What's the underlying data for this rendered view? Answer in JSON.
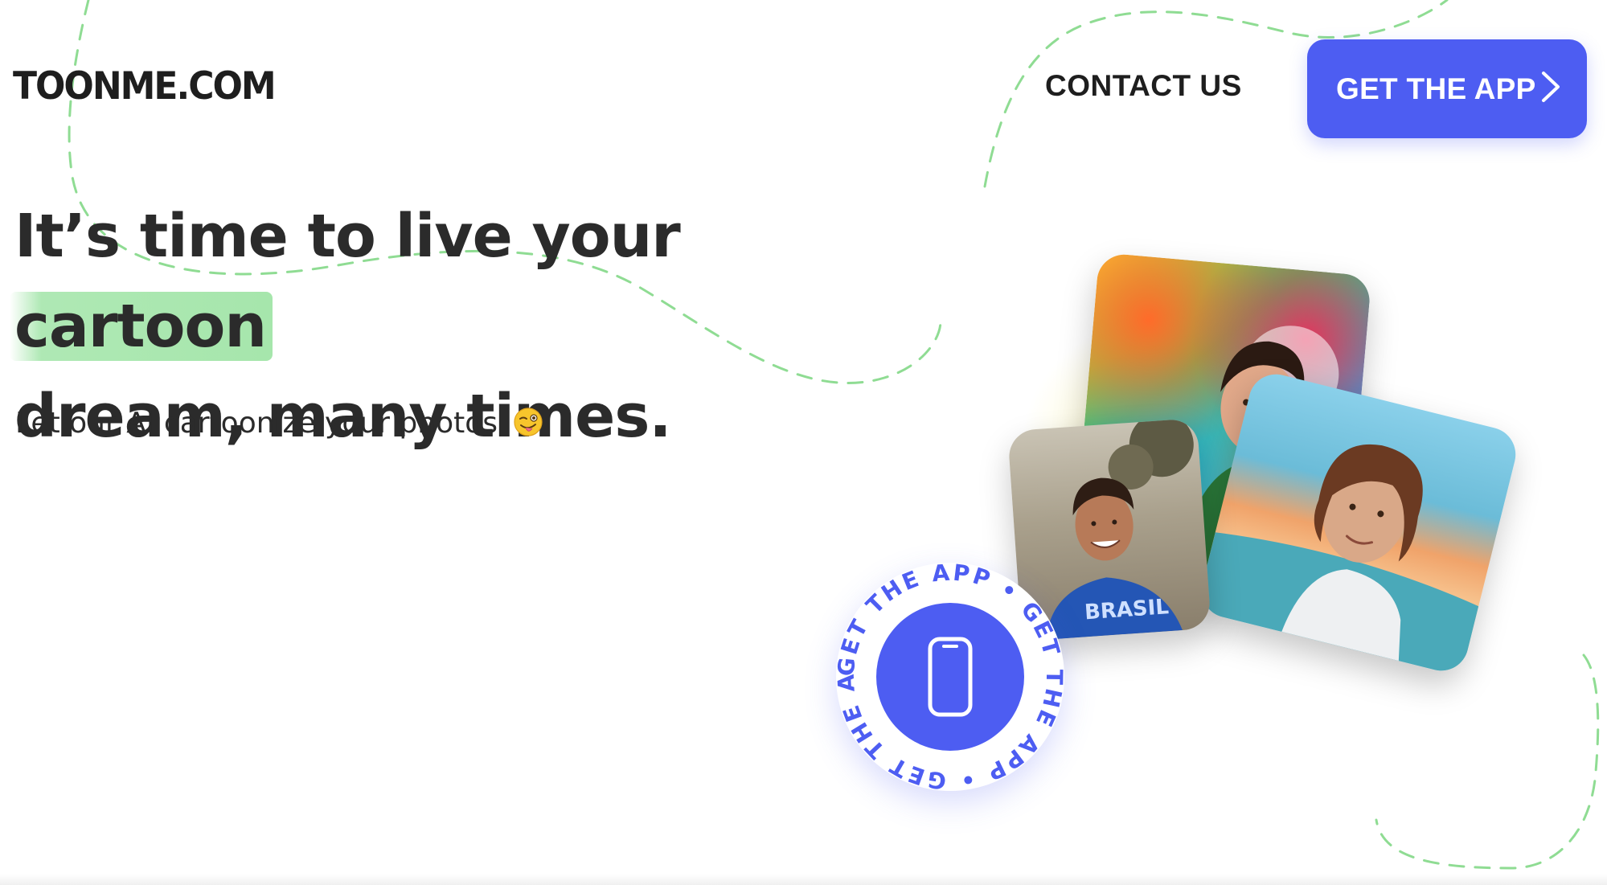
{
  "header": {
    "logo": "TOONME.COM",
    "contact_label": "CONTACT US",
    "get_app_label": "GET THE APP"
  },
  "hero": {
    "headline_part1": "It’s time to live your",
    "headline_highlight": "cartoon",
    "headline_part2": "dream, many times.",
    "subtitle": "Let our AI cartoonize your photos"
  },
  "badge": {
    "ring_text": "GET THE APP • GET THE APP • GET THE APP •"
  },
  "colors": {
    "accent": "#4d5df2",
    "highlight": "#a6e6ac",
    "dashed_line": "#8fdc93",
    "text": "#2b2b2b"
  },
  "icons": {
    "button": "chevron-right-icon",
    "badge": "smartphone-icon",
    "subtitle": "winking-face-with-tongue-icon"
  }
}
